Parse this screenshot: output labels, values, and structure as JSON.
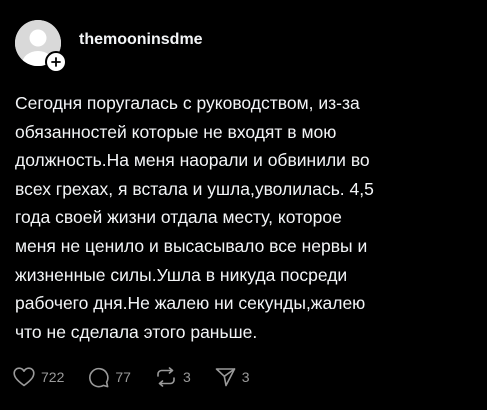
{
  "post": {
    "username": "themooninsdme",
    "text": "Сегодня поругалась с руководством, из-за\nобязанностей которые не входят в мою\nдолжность.На меня наорали и обвинили во\nвсех грехах, я встала и ушла,уволилась. 4,5\nгода своей жизни отдала месту, которое\nменя не ценило и высасывало все нервы и\nжизненные силы.Ушла в никуда посреди\nрабочего дня.Не жалею ни секунды,жалею\nчто не сделала этого раньше."
  },
  "actions": {
    "likes": "722",
    "comments": "77",
    "reposts": "3",
    "shares": "3"
  },
  "icons": {
    "avatar": "default-avatar-icon",
    "follow": "plus-icon",
    "like": "heart-icon",
    "comment": "comment-bubble-icon",
    "repost": "repost-icon",
    "share": "send-icon"
  },
  "colors": {
    "background": "#000000",
    "text": "#f3f5f7",
    "muted": "#9a9a9a"
  }
}
